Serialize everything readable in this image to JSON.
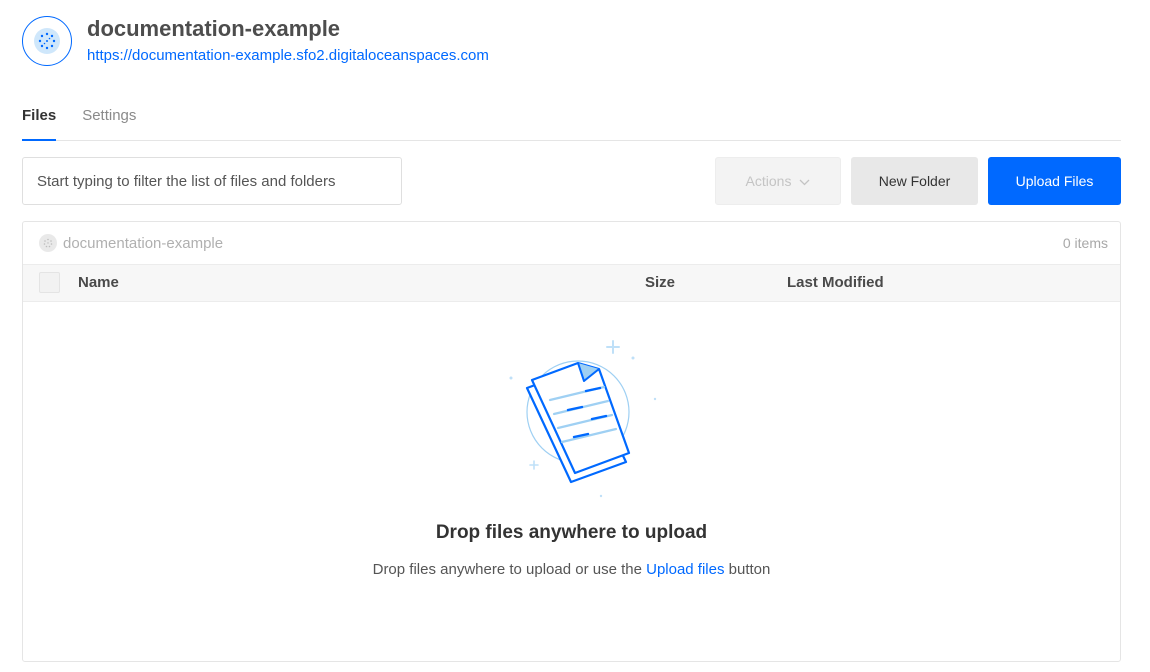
{
  "header": {
    "bucket_name": "documentation-example",
    "bucket_url": "https://documentation-example.sfo2.digitaloceanspaces.com",
    "avatar_icon": "spaces-bucket-icon"
  },
  "tabs": [
    {
      "label": "Files",
      "active": true
    },
    {
      "label": "Settings",
      "active": false
    }
  ],
  "toolbar": {
    "filter_placeholder": "Start typing to filter the list of files and folders",
    "filter_value": "",
    "actions_label": "Actions",
    "new_folder_label": "New Folder",
    "upload_label": "Upload Files"
  },
  "panel": {
    "bucket_name": "documentation-example",
    "item_count": "0 items",
    "columns": {
      "name": "Name",
      "size": "Size",
      "modified": "Last Modified"
    }
  },
  "empty_state": {
    "title": "Drop files anywhere to upload",
    "subtitle_before": "Drop files anywhere to upload or use the ",
    "subtitle_link": "Upload files",
    "subtitle_after": " button"
  },
  "colors": {
    "accent": "#0069ff",
    "illustration_light": "#9fd0f3"
  }
}
